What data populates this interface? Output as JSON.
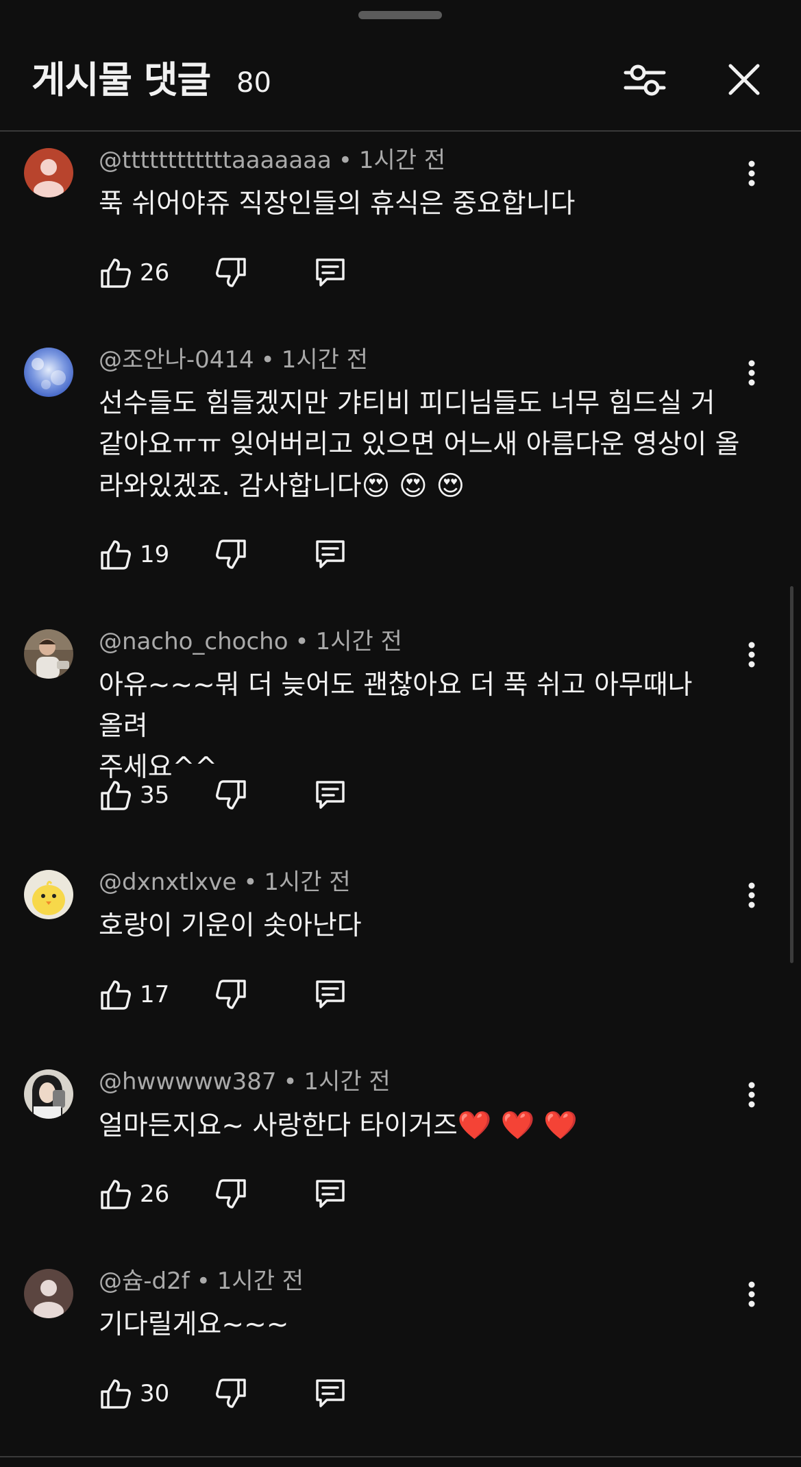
{
  "header": {
    "title": "게시물 댓글",
    "count": "80",
    "filter_icon": "sliders-icon",
    "close_icon": "close-icon"
  },
  "colors": {
    "background": "#0f0f0f",
    "primary_text": "#f1f1f1",
    "secondary_text": "#aaaaaa",
    "divider": "#3a3a3a"
  },
  "comments": [
    {
      "author": "@ttttttttttttaaaaaaa",
      "time": "1시간 전",
      "lines": [
        "푹 쉬어야쥬 직장인들의 휴식은 중요합니다"
      ],
      "emojis": "",
      "likes": "26"
    },
    {
      "author": "@조안나-0414",
      "time": "1시간 전",
      "lines": [
        "선수들도 힘들겠지만 갸티비 피디님들도 너무 힘드실 거",
        "같아요ㅠㅠ 잊어버리고 있으면 어느새 아름다운 영상이 올",
        "라와있겠죠. 감사합니다"
      ],
      "emojis": "😍 😍 😍",
      "likes": "19"
    },
    {
      "author": "@nacho_chocho",
      "time": "1시간 전",
      "lines": [
        "아유~~~뭐 더 늦어도 괜찮아요 더 푹 쉬고 아무때나 올려",
        "주세요^^"
      ],
      "emojis": "",
      "likes": "35"
    },
    {
      "author": "@dxnxtlxve",
      "time": "1시간 전",
      "lines": [
        "호랑이 기운이 솟아난다"
      ],
      "emojis": "",
      "likes": "17"
    },
    {
      "author": "@hwwwww387",
      "time": "1시간 전",
      "lines": [
        "얼마든지요~ 사랑한다 타이거즈"
      ],
      "emojis": "❤️ ❤️ ❤️",
      "likes": "26"
    },
    {
      "author": "@슘-d2f",
      "time": "1시간 전",
      "lines": [
        "기다릴게요~~~"
      ],
      "emojis": "",
      "likes": "30"
    }
  ]
}
